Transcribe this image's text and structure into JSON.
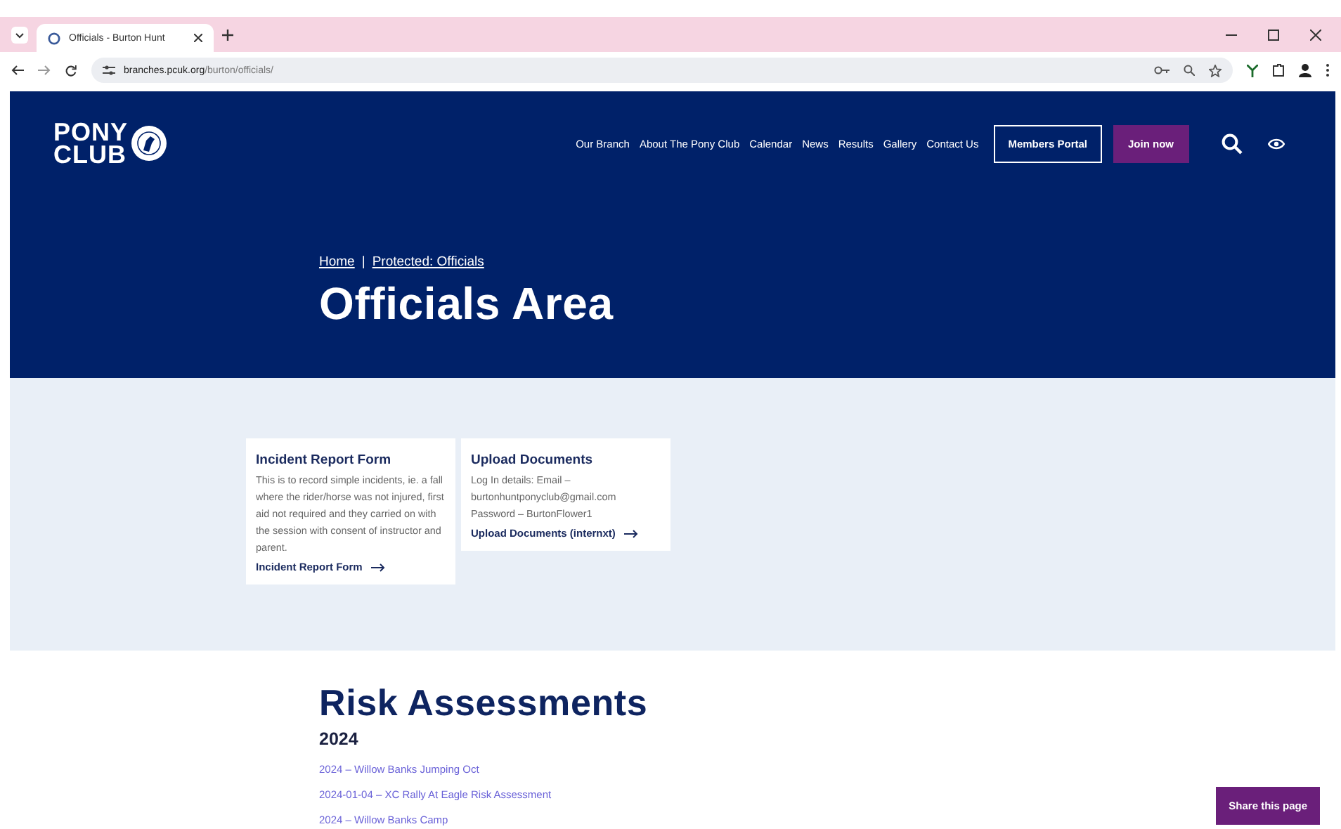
{
  "browser": {
    "tab_title": "Officials - Burton Hunt",
    "url_host": "branches.pcuk.org",
    "url_path": "/burton/officials/"
  },
  "site": {
    "logo_lines": [
      "PONY",
      "CLUB"
    ],
    "nav": [
      "Our Branch",
      "About The Pony Club",
      "Calendar",
      "News",
      "Results",
      "Gallery",
      "Contact Us"
    ],
    "members_portal": "Members Portal",
    "join": "Join now"
  },
  "hero": {
    "breadcrumbs": [
      "Home",
      "Protected: Officials"
    ],
    "separator": "|",
    "title": "Officials Area"
  },
  "cards": [
    {
      "title": "Incident Report Form",
      "body": [
        "This is to record simple incidents, ie. a fall where the rider/horse was not injured, first aid not required and they carried on with the session with consent of instructor and parent."
      ],
      "link": "Incident Report Form"
    },
    {
      "title": "Upload Documents",
      "body": [
        "Log In details: Email – burtonhuntponyclub@gmail.com",
        "Password – BurtonFlower1"
      ],
      "link": "Upload Documents (internxt)"
    }
  ],
  "risk": {
    "title": "Risk Assessments",
    "year": "2024",
    "links": [
      "2024 – Willow Banks Jumping Oct",
      "2024-01-04 – XC Rally At Eagle Risk Assessment",
      "2024 – Willow Banks Camp"
    ]
  },
  "share": "Share this page"
}
